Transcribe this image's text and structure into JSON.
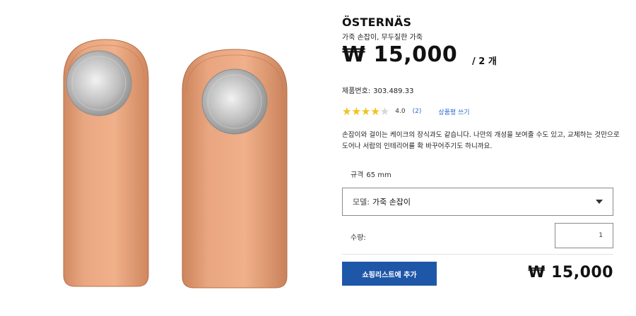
{
  "product": {
    "name": "ÖSTERNÄS",
    "subtitle": "가죽 손잡이, 무두질한 가죽",
    "price": "₩ 15,000",
    "price_unit": "/ 2 개",
    "article_label": "제품번호:",
    "article_number": "303.489.33",
    "rating": {
      "value": "4.0",
      "fraction": 0.8,
      "count": "(2)",
      "review_link": "상품평 쓰기",
      "star_color": "#f3c318"
    },
    "description": "손잡이와 걸이는 케이크의 장식과도 같습니다. 나만의 개성을 보여줄 수도 있고, 교체하는 것만으로 도어나 서랍의 인테리어를 확 바꾸어주기도 하니까요.",
    "spec_label": "규격",
    "spec_value": "65 mm",
    "model_label": "모델:",
    "model_value": "가죽 손잡이",
    "quantity_label": "수량:",
    "quantity_value": "1",
    "add_to_cart": "쇼핑리스트에 추가",
    "total_price": "₩ 15,000"
  },
  "colors": {
    "accent": "#1f57a8",
    "leather": "#e7a27c",
    "link": "#2a6ad1"
  }
}
